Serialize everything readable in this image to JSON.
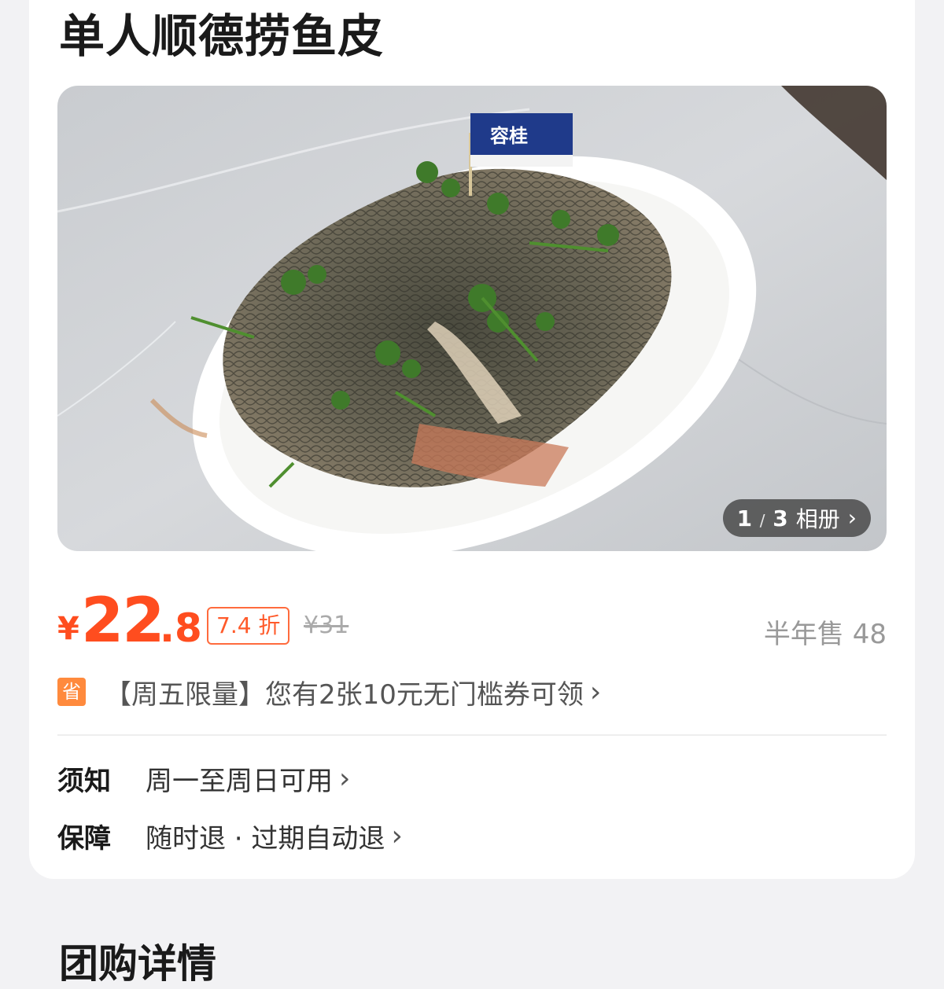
{
  "product": {
    "title": "单人顺德捞鱼皮",
    "album": {
      "current": "1",
      "separator": "/",
      "total": "3",
      "label": "相册"
    },
    "flag_text": "容桂"
  },
  "price": {
    "currency": "¥",
    "integer": "22",
    "decimal": ".8",
    "discount": "7.4 折",
    "original": "¥31",
    "sold": "半年售 48"
  },
  "coupon": {
    "badge": "省",
    "text": "【周五限量】您有2张10元无门槛券可领"
  },
  "notice": {
    "label": "须知",
    "value": "周一至周日可用"
  },
  "guarantee": {
    "label": "保障",
    "value": "随时退 · 过期自动退"
  },
  "next_section": {
    "title": "团购详情"
  },
  "colors": {
    "accent": "#ff4d1f",
    "coupon_badge": "#ff8a3d",
    "background": "#f2f2f4"
  }
}
